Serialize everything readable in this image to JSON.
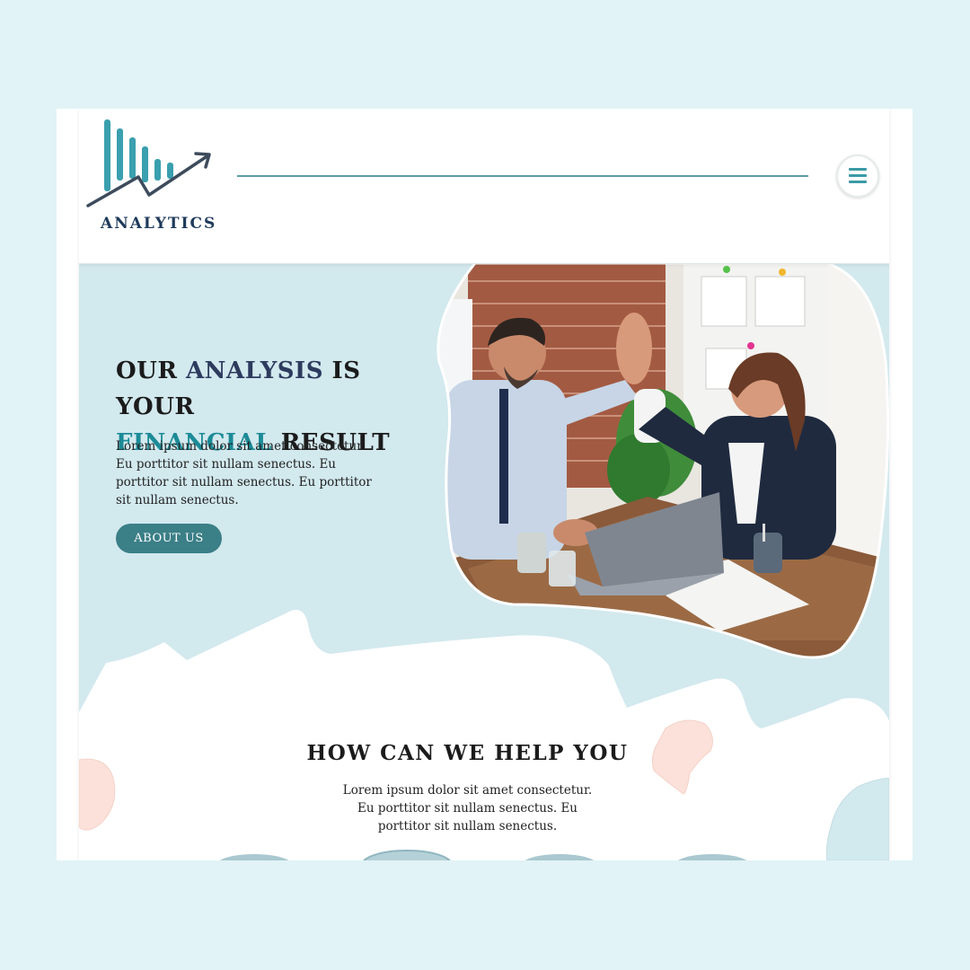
{
  "logo": {
    "text": "ANALYTICS"
  },
  "header": {
    "menu_icon": "hamburger-menu-icon"
  },
  "hero": {
    "title_parts": [
      "OUR ",
      "ANALYSIS",
      " IS YOUR",
      "FINANCIAL",
      " RESULT"
    ],
    "body": "Lorem ipsum dolor sit amet consectetur. Eu porttitor sit nullam senectus. Eu porttitor sit nullam senectus. Eu porttitor sit nullam senectus.",
    "button_label": "ABOUT US"
  },
  "how": {
    "title": "HOW CAN WE HELP YOU",
    "body": "Lorem ipsum dolor sit amet consectetur. Eu porttitor sit nullam senectus. Eu porttitor sit nullam senectus."
  },
  "colors": {
    "background": "#e1f3f7",
    "hero_bg": "#d2e9ee",
    "navy": "#2d3b5e",
    "teal": "#1c8b97",
    "button": "#3b7f87",
    "peach": "#fde3dc"
  }
}
